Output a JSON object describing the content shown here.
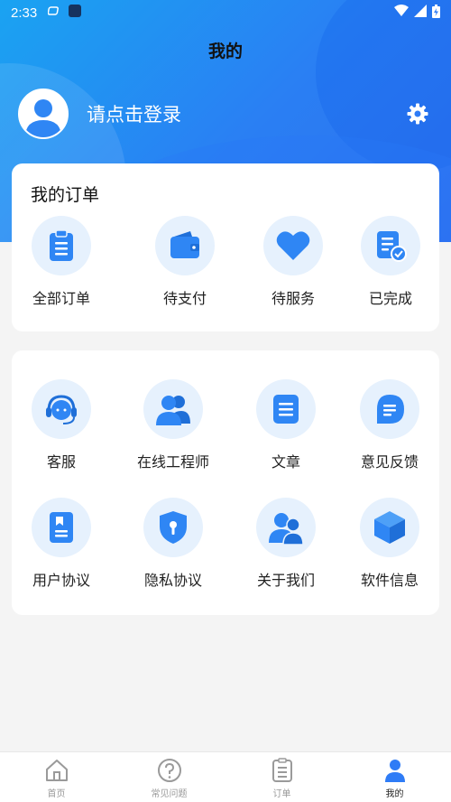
{
  "status_bar": {
    "time": "2:33"
  },
  "header": {
    "title": "我的"
  },
  "profile": {
    "login_prompt": "请点击登录"
  },
  "orders": {
    "title": "我的订单",
    "items": [
      {
        "label": "全部订单",
        "icon": "clipboard-icon"
      },
      {
        "label": "待支付",
        "icon": "wallet-icon"
      },
      {
        "label": "待服务",
        "icon": "heart-icon"
      },
      {
        "label": "已完成",
        "icon": "completed-doc-icon"
      }
    ]
  },
  "services": {
    "items": [
      {
        "label": "客服",
        "icon": "headset-icon"
      },
      {
        "label": "在线工程师",
        "icon": "engineer-icon"
      },
      {
        "label": "文章",
        "icon": "article-icon"
      },
      {
        "label": "意见反馈",
        "icon": "feedback-icon"
      },
      {
        "label": "用户协议",
        "icon": "user-agreement-icon"
      },
      {
        "label": "隐私协议",
        "icon": "privacy-shield-icon"
      },
      {
        "label": "关于我们",
        "icon": "about-us-icon"
      },
      {
        "label": "软件信息",
        "icon": "cube-icon"
      }
    ]
  },
  "tabbar": {
    "tabs": [
      {
        "label": "首页",
        "icon": "home-icon"
      },
      {
        "label": "常见问题",
        "icon": "question-icon"
      },
      {
        "label": "订单",
        "icon": "order-list-icon"
      },
      {
        "label": "我的",
        "icon": "person-icon",
        "active": true
      }
    ]
  },
  "colors": {
    "accent": "#2f7cf6",
    "icon_bg": "#e6f1fd",
    "hero_start": "#1aa3f2",
    "hero_end": "#2f6ff0"
  }
}
